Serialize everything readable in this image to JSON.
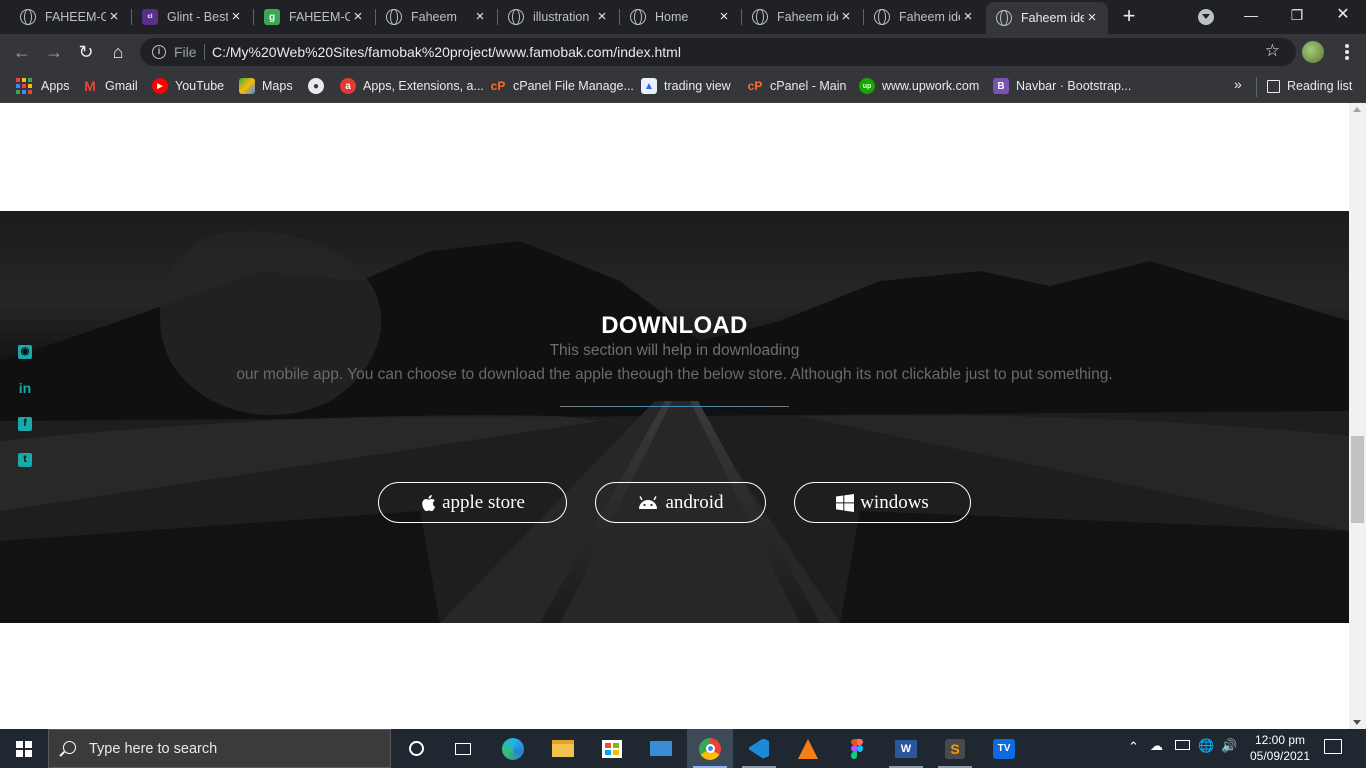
{
  "browser": {
    "tabs": [
      {
        "title": "FAHEEM-GLINT",
        "icon": "globe-icon",
        "active": false
      },
      {
        "title": "Glint - Best",
        "icon": "colorlib-icon",
        "active": false
      },
      {
        "title": "FAHEEM-GLINT",
        "icon": "g-favicon-icon",
        "active": false
      },
      {
        "title": "Faheem",
        "icon": "globe-icon",
        "active": false
      },
      {
        "title": "illustration",
        "icon": "globe-icon",
        "active": false
      },
      {
        "title": "Home",
        "icon": "globe-icon",
        "active": false
      },
      {
        "title": "Faheem idea",
        "icon": "globe-icon",
        "active": false
      },
      {
        "title": "Faheem idea",
        "icon": "globe-icon",
        "active": false
      },
      {
        "title": "Faheem idea",
        "icon": "globe-icon",
        "active": true
      }
    ],
    "omnibox": {
      "scheme_label": "File",
      "url": "C:/My%20Web%20Sites/famobak%20project/www.famobak.com/index.html"
    },
    "bookmarks": [
      {
        "label": "Apps",
        "icon": "apps-grid-icon"
      },
      {
        "label": "Gmail",
        "icon": "gmail-icon"
      },
      {
        "label": "YouTube",
        "icon": "youtube-icon"
      },
      {
        "label": "Maps",
        "icon": "maps-icon"
      },
      {
        "label": "",
        "icon": "globe-icon"
      },
      {
        "label": "Apps, Extensions, a...",
        "icon": "chrome-apps-icon"
      },
      {
        "label": "cPanel File Manage...",
        "icon": "cpanel-icon"
      },
      {
        "label": "trading view",
        "icon": "tradingview-icon"
      },
      {
        "label": "cPanel - Main",
        "icon": "cpanel-icon"
      },
      {
        "label": "www.upwork.com",
        "icon": "upwork-icon"
      },
      {
        "label": "Navbar · Bootstrap...",
        "icon": "bootstrap-icon"
      }
    ],
    "overflow_label": "»",
    "reading_list_label": "Reading list"
  },
  "page": {
    "download": {
      "title": "DOWNLOAD",
      "line1": "This section will help in downloading",
      "line2": "our mobile app. You can choose to download the apple theough the below store. Although its not clickable just to put something.",
      "buttons": [
        {
          "label": "apple store",
          "icon": "apple-icon"
        },
        {
          "label": "android",
          "icon": "android-icon"
        },
        {
          "label": "windows",
          "icon": "windows-icon"
        }
      ]
    },
    "social": [
      "instagram-icon",
      "linkedin-icon",
      "facebook-icon",
      "twitter-icon"
    ],
    "accent_color": "#18a9a9"
  },
  "taskbar": {
    "search_placeholder": "Type here to search",
    "time": "12:00 pm",
    "date": "05/09/2021"
  }
}
